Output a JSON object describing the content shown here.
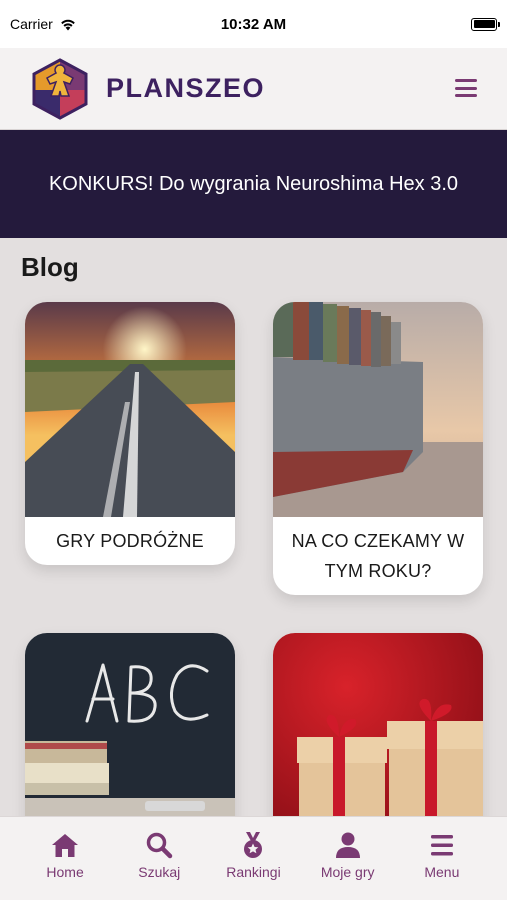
{
  "status_bar": {
    "carrier": "Carrier",
    "time": "10:32 AM"
  },
  "header": {
    "brand": "PLANSZEO",
    "menu_icon": "hamburger-icon"
  },
  "banner": {
    "text": "KONKURS! Do wygrania Neuroshima Hex 3.0"
  },
  "blog": {
    "title": "Blog",
    "cards": [
      {
        "title": "GRY PODRÓŻNE",
        "image": "road-sunset-image"
      },
      {
        "title": "NA CO CZEKAMY W TYM ROKU?",
        "image": "cargo-ship-image"
      },
      {
        "title": "",
        "image": "chalkboard-abc-image"
      },
      {
        "title": "",
        "image": "gift-boxes-image"
      }
    ]
  },
  "tab_bar": {
    "tabs": [
      {
        "label": "Home",
        "icon": "home-icon"
      },
      {
        "label": "Szukaj",
        "icon": "search-icon"
      },
      {
        "label": "Rankingi",
        "icon": "medal-icon"
      },
      {
        "label": "Moje gry",
        "icon": "user-icon"
      },
      {
        "label": "Menu",
        "icon": "menu-icon"
      }
    ]
  },
  "colors": {
    "accent": "#7a3a73",
    "brand": "#3d2160",
    "banner_bg": "#241a3c",
    "page_bg": "#e3dfdf"
  }
}
